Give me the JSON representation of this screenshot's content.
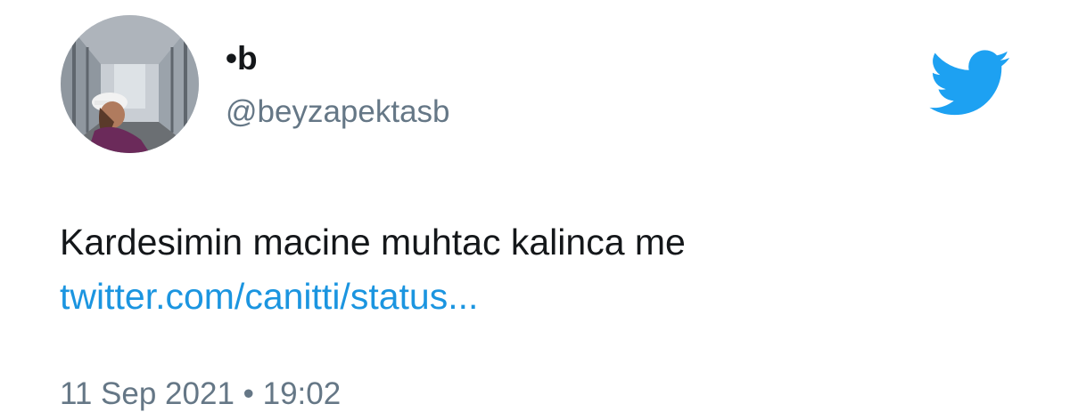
{
  "author": {
    "display_name": "•b",
    "handle": "@beyzapektasb"
  },
  "tweet": {
    "text": "Kardesimin macine muhtac kalinca me",
    "link": "twitter.com/canitti/status...",
    "timestamp": "11 Sep 2021 • 19:02"
  },
  "icons": {
    "brand": "twitter-bird-icon",
    "avatar": "profile-avatar-photo"
  },
  "colors": {
    "brand_blue": "#1da1f2",
    "link_blue": "#1b95e0",
    "text": "#14171a",
    "secondary_text": "#657786"
  }
}
